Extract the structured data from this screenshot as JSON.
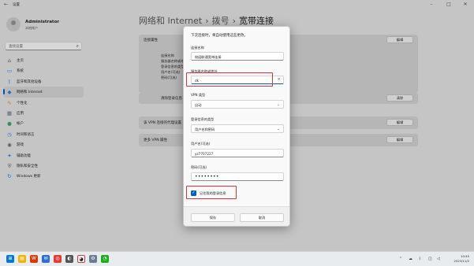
{
  "window": {
    "title": "设置"
  },
  "user": {
    "name": "Administrator",
    "account_type": "本地帐户"
  },
  "search": {
    "placeholder": "查找设置"
  },
  "nav": [
    {
      "label": "主页",
      "icon": "home-icon"
    },
    {
      "label": "系统",
      "icon": "system-icon"
    },
    {
      "label": "蓝牙和其他设备",
      "icon": "bluetooth-icon"
    },
    {
      "label": "网络和 Internet",
      "icon": "network-icon",
      "active": true
    },
    {
      "label": "个性化",
      "icon": "personalization-icon"
    },
    {
      "label": "应用",
      "icon": "apps-icon"
    },
    {
      "label": "帐户",
      "icon": "accounts-icon"
    },
    {
      "label": "时间和语言",
      "icon": "time-language-icon"
    },
    {
      "label": "游戏",
      "icon": "gaming-icon"
    },
    {
      "label": "辅助功能",
      "icon": "accessibility-icon"
    },
    {
      "label": "隐私和安全性",
      "icon": "privacy-icon"
    },
    {
      "label": "Windows 更新",
      "icon": "windows-update-icon"
    }
  ],
  "breadcrumb": {
    "part1": "网络和 Internet",
    "part2": "拨号",
    "part3": "宽带连接"
  },
  "background": {
    "connection_props_title": "连接属性",
    "edit_label": "编辑",
    "props": [
      "连接名称",
      "服务器名称或地址",
      "登录信息的类型",
      "用户名(可选)",
      "密码(可选)"
    ],
    "clear_login_label": "清除登录信息",
    "clear_label": "清除",
    "vpn_advanced_title": "该 VPN 连接的代理设置",
    "more_vpn_title": "更多 VPN 属性"
  },
  "dialog": {
    "hint": "下次连接时，将自动使用这些更改。",
    "conn_name_label": "连接名称",
    "conn_name_value": "校园联通宽带连接",
    "server_label": "服务器名称或地址",
    "server_value": "dk",
    "vpn_type_label": "VPN 类型",
    "vpn_type_value": "自动",
    "login_type_label": "登录信息的类型",
    "login_type_value": "用户名和密码",
    "username_label": "用户名(可选)",
    "username_value": "yz7707227",
    "password_label": "密码(可选)",
    "password_value": "••••••••",
    "remember_label": "记住我的登录信息",
    "remember_checked": true,
    "save_label": "保存",
    "cancel_label": "取消"
  },
  "taskbar": {
    "time": "10:45",
    "date": "2023/11/2"
  },
  "colors": {
    "accent": "#005fb8",
    "highlight": "#e5303a"
  }
}
